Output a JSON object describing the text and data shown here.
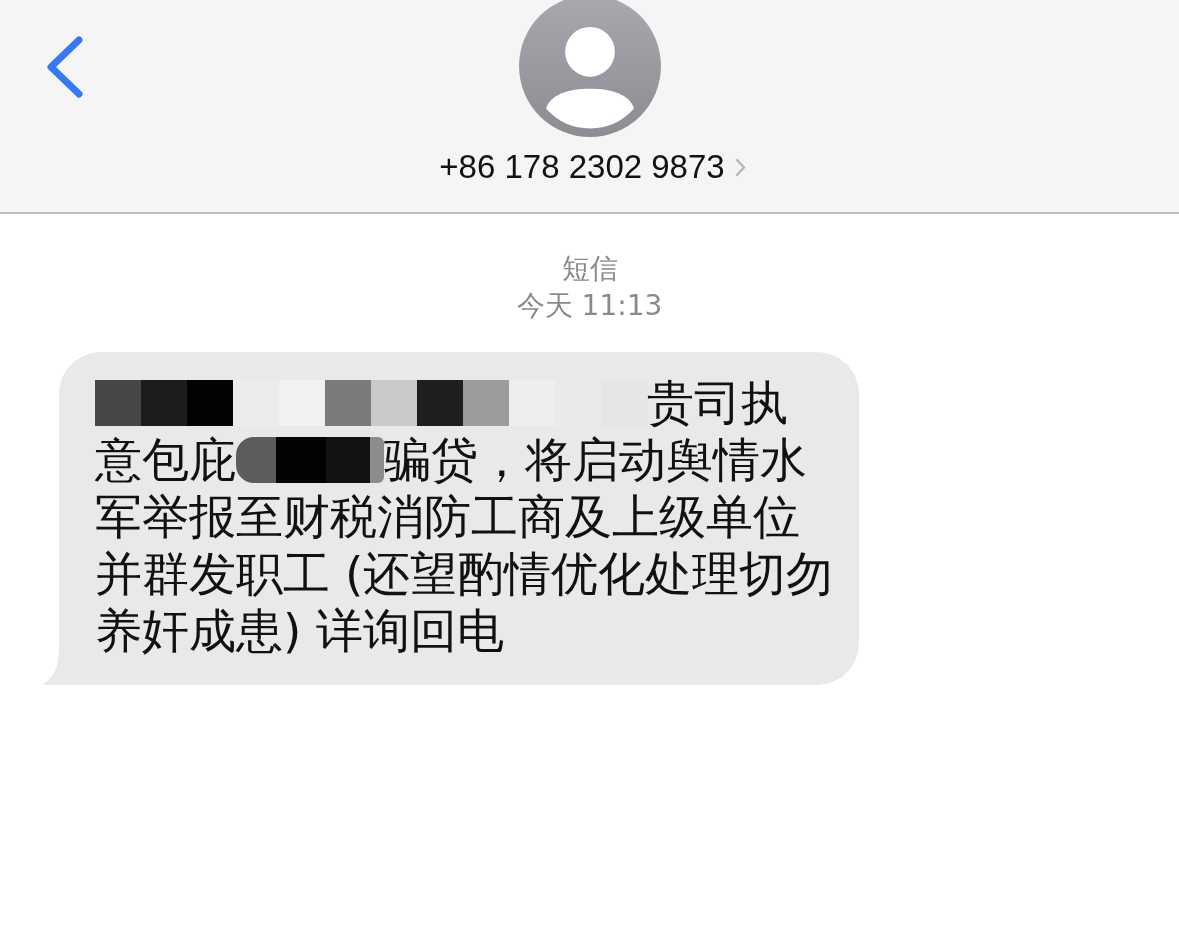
{
  "header": {
    "contact_number": "+86 178 2302 9873"
  },
  "conversation": {
    "service_label": "短信",
    "timestamp": "今天 11:13"
  },
  "messages": [
    {
      "kind": "incoming",
      "lines": [
        {
          "segments": [
            {
              "kind": "redacted"
            },
            {
              "kind": "text",
              "text": "贵司执"
            }
          ]
        },
        {
          "segments": [
            {
              "kind": "text",
              "text": "意包庇"
            },
            {
              "kind": "redacted"
            },
            {
              "kind": "text",
              "text": "骗贷，将启动舆情水"
            }
          ]
        },
        {
          "segments": [
            {
              "kind": "text",
              "text": "军举报至财税消防工商及上级单位"
            }
          ]
        },
        {
          "segments": [
            {
              "kind": "text",
              "text": "并群发职工 (还望酌情优化处理切勿"
            }
          ]
        },
        {
          "segments": [
            {
              "kind": "text",
              "text": "养奸成患) 详询回电"
            }
          ]
        }
      ]
    }
  ]
}
